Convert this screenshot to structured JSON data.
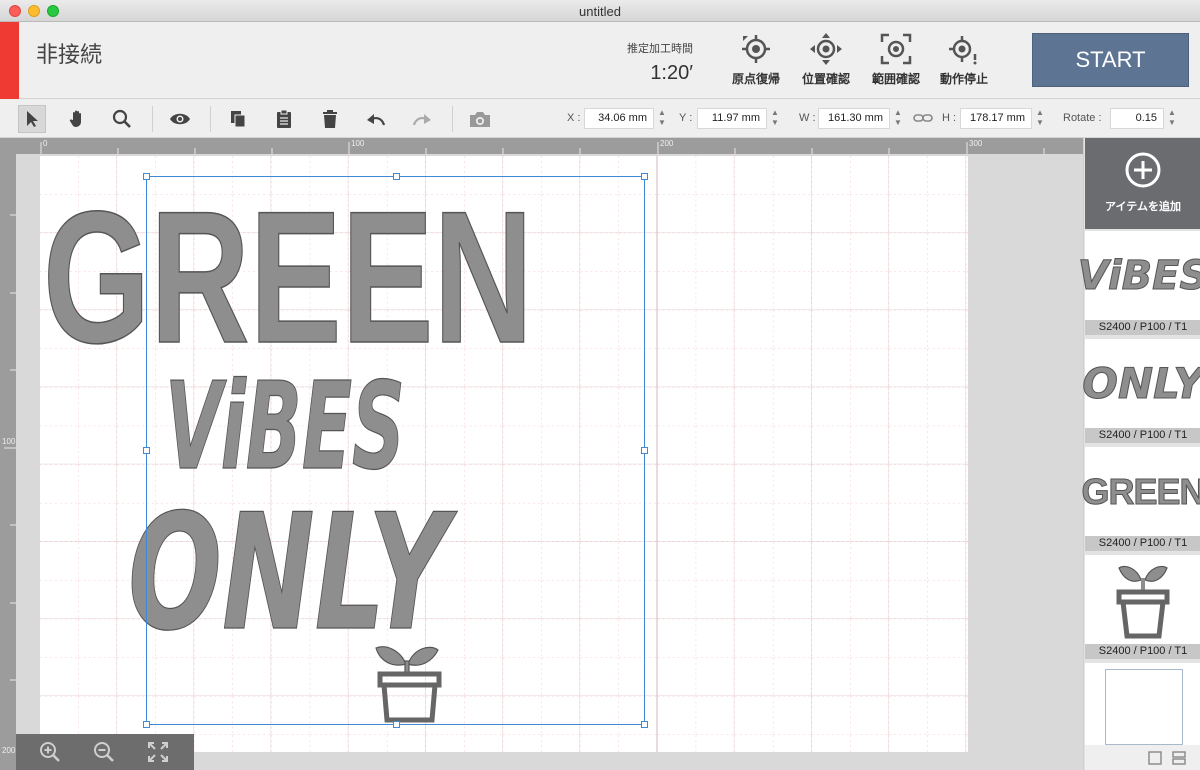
{
  "window": {
    "title": "untitled"
  },
  "header": {
    "connection_status": "非接続",
    "time_label": "推定加工時間",
    "time_value": "1:20′",
    "buttons": [
      {
        "label": "原点復帰",
        "icon": "origin-return-icon"
      },
      {
        "label": "位置確認",
        "icon": "position-check-icon"
      },
      {
        "label": "範囲確認",
        "icon": "range-check-icon"
      },
      {
        "label": "動作停止",
        "icon": "stop-operation-icon"
      }
    ],
    "start_label": "START",
    "stripe_color": "#ee3a33",
    "start_color": "#5d7592"
  },
  "toolbar": {
    "tools": [
      "select-arrow-icon",
      "hand-pan-icon",
      "zoom-magnifier-icon",
      "preview-eye-icon",
      "copy-icon",
      "paste-clipboard-icon",
      "delete-trash-icon",
      "undo-icon",
      "redo-icon",
      "camera-icon"
    ],
    "x_label": "X :",
    "x_value": "34.06 mm",
    "y_label": "Y :",
    "y_value": "11.97 mm",
    "w_label": "W :",
    "w_value": "161.30 mm",
    "h_label": "H :",
    "h_value": "178.17 mm",
    "rotate_label": "Rotate :",
    "rotate_value": "0.15"
  },
  "rulers": {
    "top": [
      "0",
      "100",
      "200",
      "300"
    ],
    "left": [
      "100",
      "200"
    ]
  },
  "artwork": {
    "line1": "GREEN",
    "line2": "ViBES",
    "line3": "ONLY"
  },
  "panel": {
    "add_label": "アイテムを追加",
    "items": [
      {
        "name": "ViBES",
        "caption": "S2400 / P100 / T1"
      },
      {
        "name": "ONLY",
        "caption": "S2400 / P100 / T1"
      },
      {
        "name": "GREEN",
        "caption": "S2400 / P100 / T1"
      },
      {
        "name": "plant-pot",
        "caption": "S2400 / P100 / T1"
      }
    ]
  }
}
